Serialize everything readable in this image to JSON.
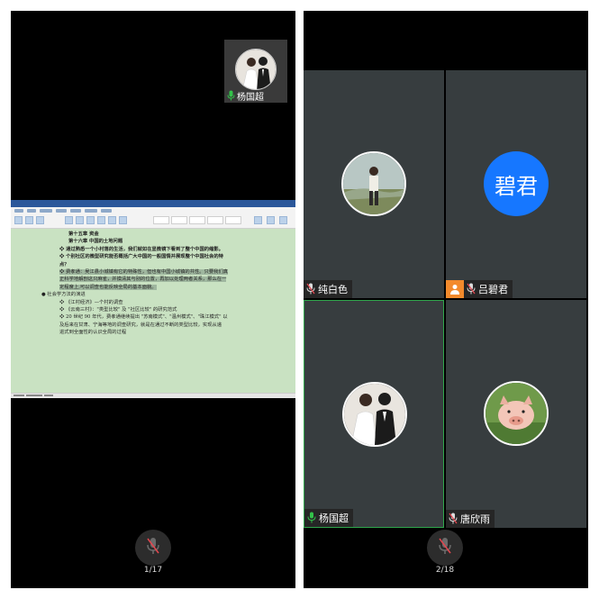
{
  "left_screen": {
    "pip": {
      "name": "杨国超"
    },
    "document": {
      "lines": [
        {
          "text": "第十五章 资金",
          "indent": 50,
          "bold": true,
          "highlight": false
        },
        {
          "text": "第十六章 中国的土地问题",
          "indent": 50,
          "bold": true,
          "highlight": false
        },
        {
          "text": "❖  通过熟悉一个小村落的生活，我们就如在显微镜下看到了整个中国的缩影。",
          "indent": 40,
          "bold": true,
          "highlight": false
        },
        {
          "text": "❖  个别社区的微型研究能否概括广大中国的一般国情并展现整个中国社会的特",
          "indent": 40,
          "bold": true,
          "highlight": false
        },
        {
          "text": "    点？",
          "indent": 40,
          "bold": true,
          "highlight": false
        },
        {
          "text": "❖  费孝通：吴江县小城镇有它的特殊性，但也有中国小城镇的共性。只要我们真",
          "indent": 40,
          "bold": false,
          "highlight": true
        },
        {
          "text": "    正科学地解剖这只麻雀，并摸清其与别的位置，再加以处理两者关系，那么在一",
          "indent": 40,
          "bold": false,
          "highlight": true
        },
        {
          "text": "    定程度上,可以调查也能反映全局的基本面貌。",
          "indent": 40,
          "bold": false,
          "highlight": true
        },
        {
          "text": "●  社会学方法的演进",
          "indent": 20,
          "bold": false,
          "highlight": false
        },
        {
          "text": "❖  《江村经济》—个村的调查",
          "indent": 40,
          "bold": false,
          "highlight": false
        },
        {
          "text": "❖  《云南三村》：\"类型比较\" 及 \"社区比较\" 的研究范式",
          "indent": 40,
          "bold": false,
          "highlight": false
        },
        {
          "text": "❖  20 世纪 90 年代，费孝通继续提出 \"苏南模式\"、\"温州模式\"、\"珠江模式\" 以",
          "indent": 40,
          "bold": false,
          "highlight": false
        },
        {
          "text": "    及后来在甘肃、宁海等地的调查研究，就是在通过不断的类型比较，实现从递",
          "indent": 40,
          "bold": false,
          "highlight": false
        },
        {
          "text": "    进式到全面性的认识全局的过程",
          "indent": 40,
          "bold": false,
          "highlight": false
        }
      ]
    },
    "page_indicator": "1/17"
  },
  "right_screen": {
    "tiles": [
      {
        "name": "纯白色",
        "avatar": "photo-hiker",
        "active": false
      },
      {
        "name": "吕碧君",
        "avatar_text": "碧君",
        "avatar_color": "#1677ff",
        "active": false
      },
      {
        "name": "杨国超",
        "avatar": "photo-wedding",
        "active": true
      },
      {
        "name": "唐欣雨",
        "avatar": "photo-piglet",
        "active": false
      }
    ],
    "page_indicator": "2/18"
  },
  "colors": {
    "mic_green": "#33c24a",
    "mic_muted": "#e0474f",
    "letter_avatar": "#1677ff",
    "active_border": "#2fa64b"
  }
}
